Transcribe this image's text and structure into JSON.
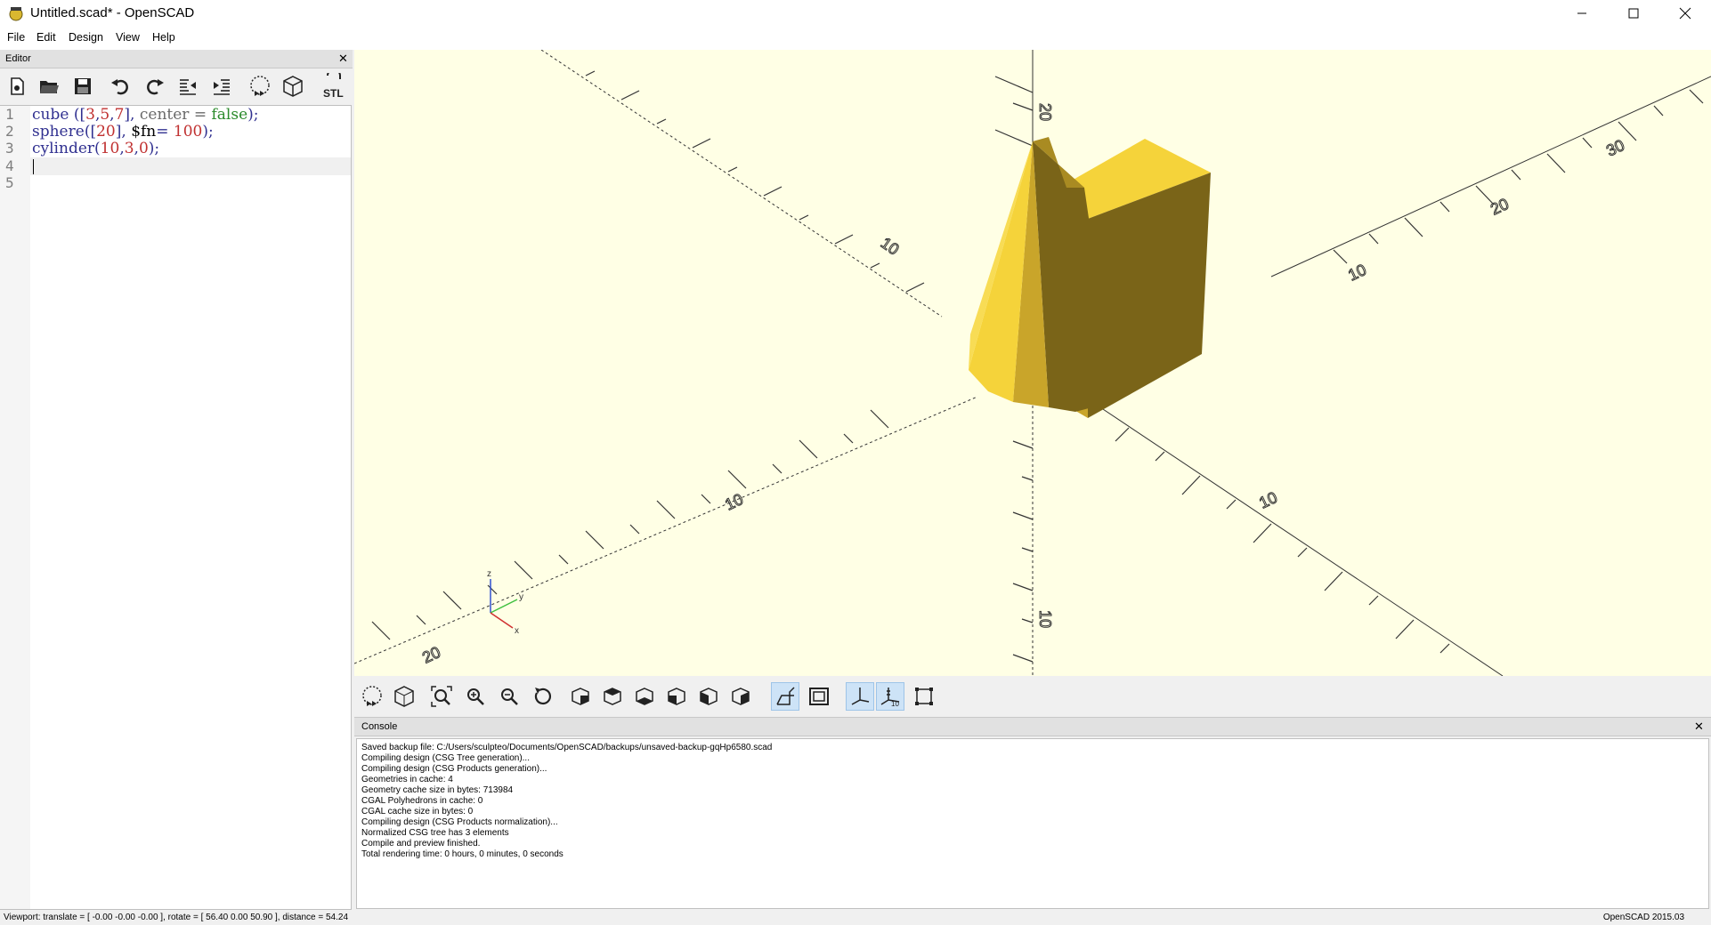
{
  "window": {
    "title": "Untitled.scad* - OpenSCAD",
    "icon": "openscad-app-icon"
  },
  "menu": [
    "File",
    "Edit",
    "Design",
    "View",
    "Help"
  ],
  "editor": {
    "panel_title": "Editor",
    "toolbar_icons": [
      "new-file-icon",
      "open-file-icon",
      "save-icon",
      "undo-icon",
      "redo-icon",
      "unindent-icon",
      "indent-icon",
      "preview-icon",
      "render-icon",
      "export-stl-icon"
    ],
    "stl_label": "STL",
    "line_numbers": [
      "1",
      "2",
      "3",
      "4",
      "5"
    ],
    "code": {
      "line1": {
        "fn": "cube",
        "p1": " (",
        "b1": "[",
        "n1": "3",
        "c1": ",",
        "n2": "5",
        "c2": ",",
        "n3": "7",
        "b2": "]",
        "c3": ", ",
        "arg": "center",
        "eq": " = ",
        "val": "false",
        "end": ");"
      },
      "line2": {
        "fn": "sphere",
        "p1": "(",
        "b1": "[",
        "n1": "20",
        "b2": "]",
        "c1": ", ",
        "var": "$fn",
        "eq": "= ",
        "n2": "100",
        "end": ");"
      },
      "line3": {
        "fn": "cylinder",
        "p1": "(",
        "n1": "10",
        "c1": ",",
        "n2": "3",
        "c2": ",",
        "n3": "0",
        "end": ");"
      }
    }
  },
  "view_toolbar_icons": [
    "preview-icon",
    "render-icon",
    "view-all-icon",
    "zoom-in-icon",
    "zoom-out-icon",
    "reset-view-icon",
    "view-right-icon",
    "view-top-icon",
    "view-bottom-icon",
    "view-left-icon",
    "view-front-icon",
    "view-back-icon",
    "perspective-icon",
    "orthogonal-icon",
    "show-axes-icon",
    "show-scale-markers-icon",
    "show-edges-icon"
  ],
  "axis_labels": {
    "x": "x",
    "y": "y",
    "z": "z"
  },
  "scale_labels": [
    "10",
    "20",
    "30",
    "10",
    "20",
    "10",
    "20",
    "10",
    "10",
    "20"
  ],
  "console": {
    "panel_title": "Console",
    "lines": [
      "Saved backup file: C:/Users/sculpteo/Documents/OpenSCAD/backups/unsaved-backup-gqHp6580.scad",
      "Compiling design (CSG Tree generation)...",
      "Compiling design (CSG Products generation)...",
      "Geometries in cache: 4",
      "Geometry cache size in bytes: 713984",
      "CGAL Polyhedrons in cache: 0",
      "CGAL cache size in bytes: 0",
      "Compiling design (CSG Products normalization)...",
      "Normalized CSG tree has 3 elements",
      "Compile and preview finished.",
      "Total rendering time: 0 hours, 0 minutes, 0 seconds"
    ]
  },
  "status": {
    "viewport": "Viewport: translate = [ -0.00 -0.00 -0.00 ], rotate = [ 56.40 0.00 50.90 ], distance = 54.24",
    "version": "OpenSCAD 2015.03"
  },
  "colors": {
    "viewport_bg": "#ffffe5",
    "model_light": "#f5d33a",
    "model_mid": "#c9a52a",
    "model_dark": "#7a6418"
  }
}
